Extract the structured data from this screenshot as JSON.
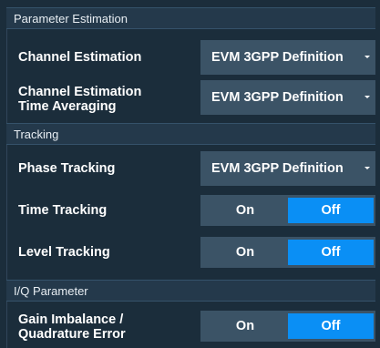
{
  "sections": [
    {
      "title": "Parameter Estimation"
    },
    {
      "title": "Tracking"
    },
    {
      "title": "I/Q Parameter"
    }
  ],
  "rows": {
    "channel_estimation": {
      "label": "Channel Estimation",
      "value": "EVM 3GPP Definition"
    },
    "channel_estimation_time_averaging": {
      "label_line1": "Channel Estimation",
      "label_line2": "Time Averaging",
      "value": "EVM 3GPP Definition"
    },
    "phase_tracking": {
      "label": "Phase Tracking",
      "value": "EVM 3GPP Definition"
    },
    "time_tracking": {
      "label": "Time Tracking",
      "on": "On",
      "off": "Off",
      "selected": "Off"
    },
    "level_tracking": {
      "label": "Level Tracking",
      "on": "On",
      "off": "Off",
      "selected": "Off"
    },
    "gain_imbalance": {
      "label_line1": "Gain Imbalance /",
      "label_line2": "Quadrature Error",
      "on": "On",
      "off": "Off",
      "selected": "Off"
    }
  },
  "colors": {
    "accent": "#0a8ff5",
    "control_bg": "#3b5366",
    "panel_bg": "#1b2d3b"
  },
  "icons": {
    "dropdown": "caret-down-icon"
  }
}
